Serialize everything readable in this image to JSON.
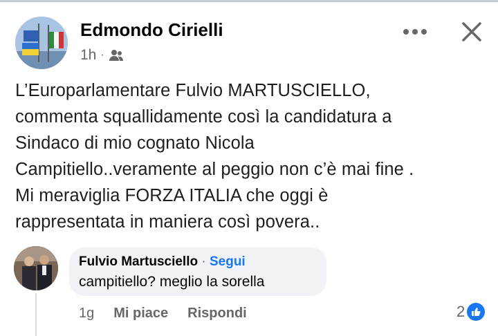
{
  "post": {
    "author": "Edmondo Cirielli",
    "time": "1h",
    "separator": "·",
    "audience_icon": "friends-icon",
    "text_lines": [
      "L’Europarlamentare Fulvio MARTUSCIELLO,",
      "commenta squallidamente così la candidatura a",
      "Sindaco di mio cognato Nicola",
      "Campitiello..veramente al peggio non c’è mai fine .",
      "Mi meraviglia FORZA ITALIA che oggi è",
      "rappresentata in maniera così povera.."
    ]
  },
  "comment": {
    "author": "Fulvio Martusciello",
    "separator": "·",
    "follow_label": "Segui",
    "text": "campitiello? meglio la sorella",
    "time": "1g",
    "like_label": "Mi piace",
    "reply_label": "Rispondi",
    "reaction_count": "2"
  },
  "colors": {
    "link_blue": "#1877f2",
    "meta_gray": "#65676b",
    "bubble_bg": "#f0f2f5"
  }
}
